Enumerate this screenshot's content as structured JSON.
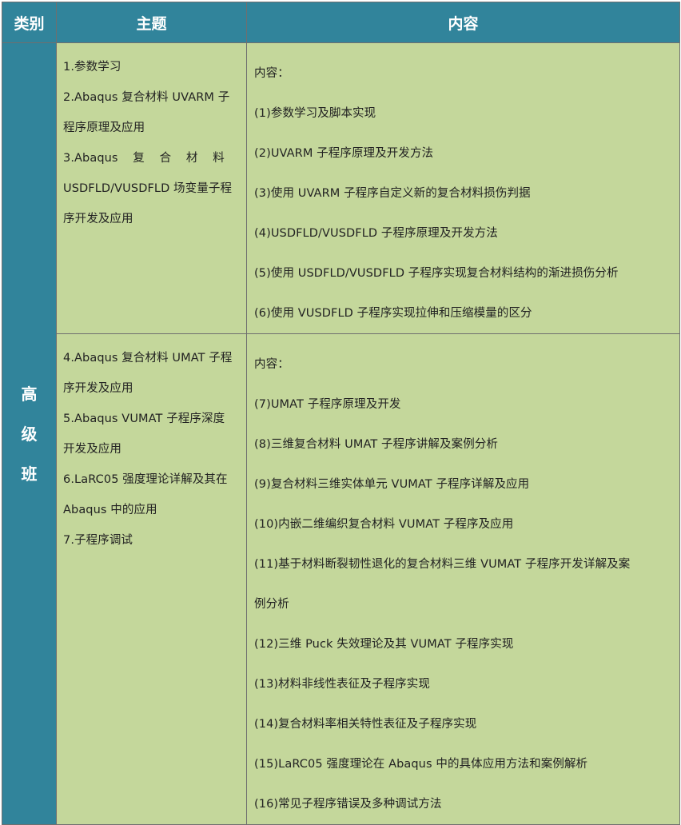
{
  "header": {
    "category": "类别",
    "topic": "主题",
    "content": "内容"
  },
  "category": [
    "高",
    "级",
    "班"
  ],
  "sections": [
    {
      "topics": [
        "1.参数学习",
        "2.Abaqus 复合材料 UVARM 子",
        "程序原理及应用",
        "3.Abaqus 复 合 材 料",
        "USDFLD/VUSDFLD 场变量子程",
        "序开发及应用"
      ],
      "content_label": "内容：",
      "items": [
        "(1)参数学习及脚本实现",
        "(2)UVARM 子程序原理及开发方法",
        "(3)使用 UVARM 子程序自定义新的复合材料损伤判据",
        "(4)USDFLD/VUSDFLD 子程序原理及开发方法",
        "(5)使用 USDFLD/VUSDFLD 子程序实现复合材料结构的渐进损伤分析",
        "(6)使用 VUSDFLD 子程序实现拉伸和压缩模量的区分"
      ]
    },
    {
      "topics": [
        "4.Abaqus 复合材料 UMAT 子程",
        "序开发及应用",
        "5.Abaqus VUMAT 子程序深度",
        "开发及应用",
        "6.LaRC05 强度理论详解及其在",
        "Abaqus 中的应用",
        "7.子程序调试"
      ],
      "content_label": "内容：",
      "items": [
        "(7)UMAT 子程序原理及开发",
        "(8)三维复合材料 UMAT 子程序讲解及案例分析",
        "(9)复合材料三维实体单元 VUMAT 子程序详解及应用",
        "(10)内嵌二维编织复合材料 VUMAT 子程序及应用",
        "(11)基于材料断裂韧性退化的复合材料三维 VUMAT 子程序开发详解及案",
        "例分析",
        "(12)三维 Puck 失效理论及其 VUMAT 子程序实现",
        "(13)材料非线性表征及子程序实现",
        "(14)复合材料率相关特性表征及子程序实现",
        "(15)LaRC05 强度理论在 Abaqus 中的具体应用方法和案例解析",
        "(16)常见子程序错误及多种调试方法"
      ]
    }
  ]
}
